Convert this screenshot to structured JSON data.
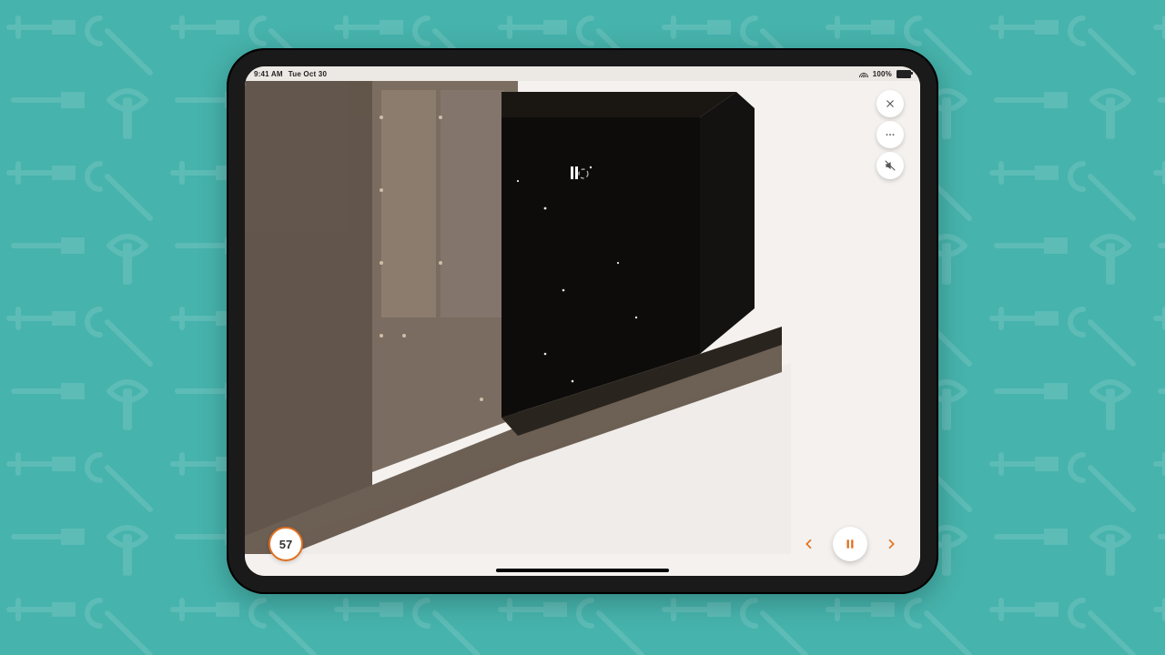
{
  "statusbar": {
    "time": "9:41 AM",
    "date": "Tue Oct 30",
    "battery_pct": "100%"
  },
  "step": {
    "number": "57"
  },
  "icons": {
    "close": "close-icon",
    "more": "more-icon",
    "mute": "mute-icon",
    "prev": "chevron-left-icon",
    "next": "chevron-right-icon",
    "pause": "pause-icon"
  },
  "colors": {
    "accent": "#e0701f",
    "wallpaper": "#46b3ac",
    "screen_bg": "#f4f1ee",
    "cabinet_front": "#6a5a4d",
    "cabinet_side": "#4e4035",
    "dark_panel": "#0e0c0b"
  }
}
